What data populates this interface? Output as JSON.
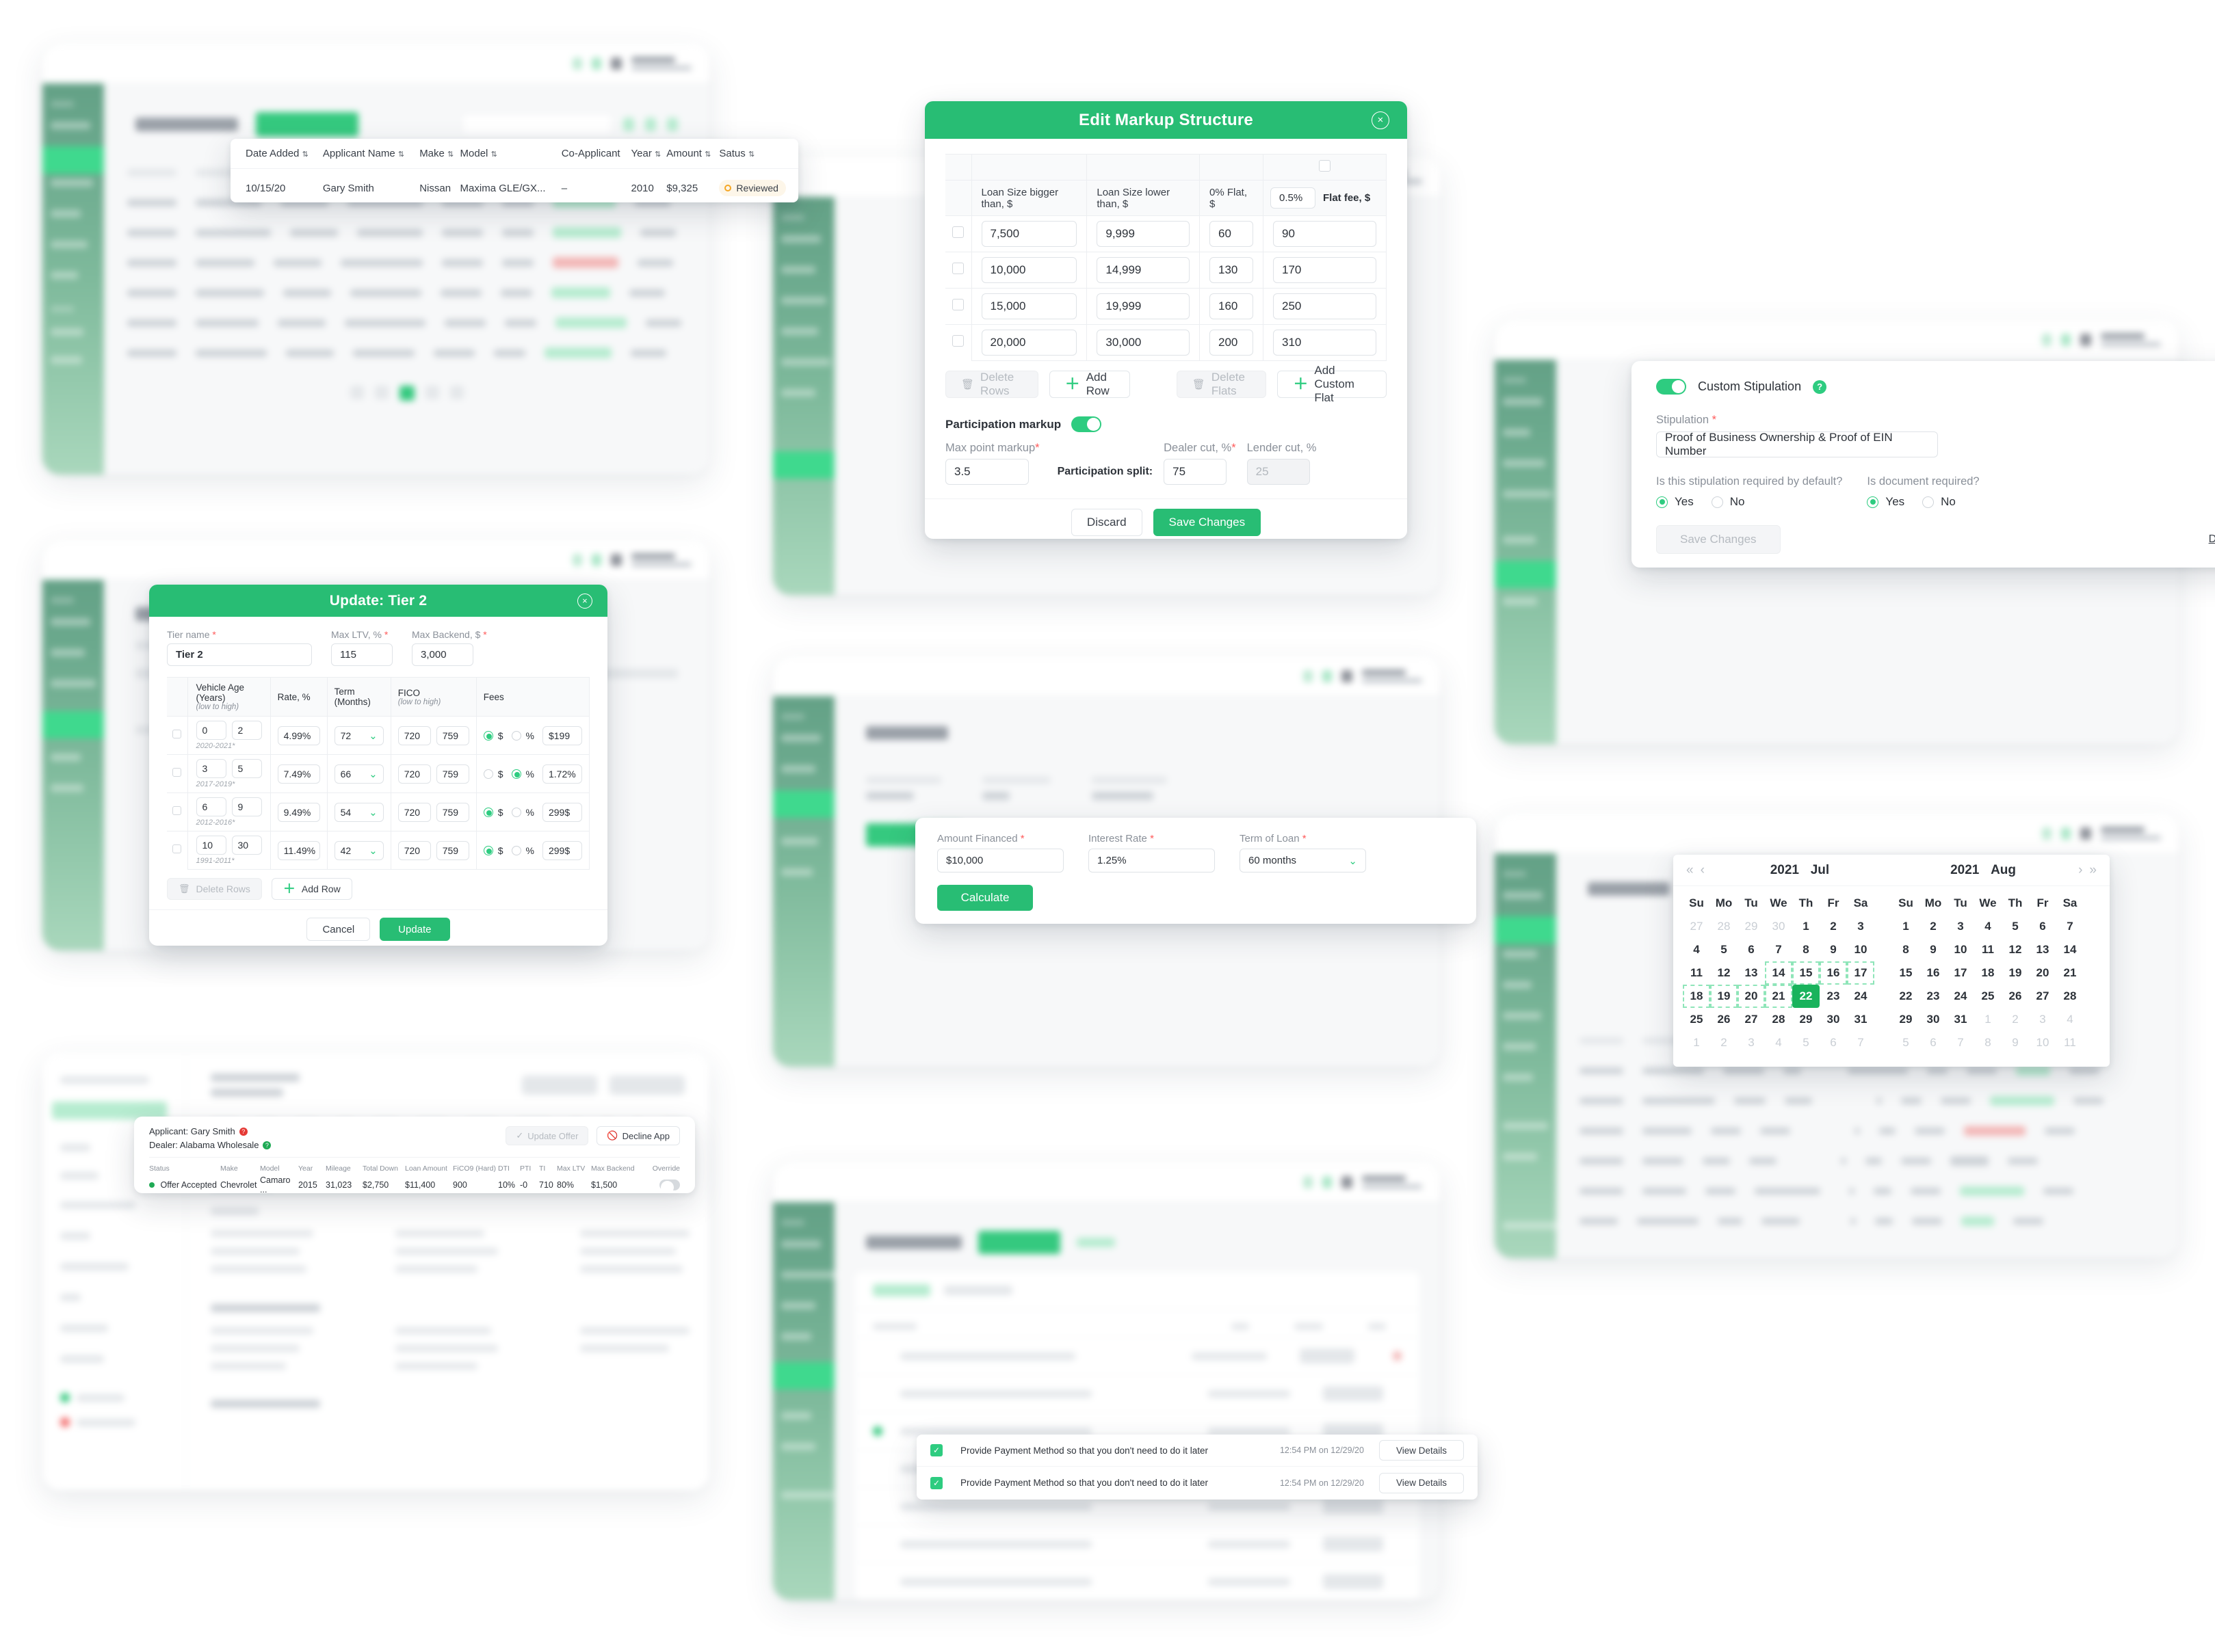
{
  "app": {
    "brand_green": "#28bd74",
    "accent_green": "#2ecc80"
  },
  "applications_table": {
    "columns": [
      "Date Added",
      "Applicant Name",
      "Make",
      "Model",
      "Co-Applicant",
      "Year",
      "Amount",
      "Satus"
    ],
    "rows": [
      {
        "date_added": "10/15/20",
        "applicant_name": "Gary Smith",
        "make": "Nissan",
        "model": "Maxima GLE/GX...",
        "co_applicant": "–",
        "year": "2010",
        "amount": "$9,325",
        "status": "Reviewed"
      }
    ]
  },
  "markup_modal": {
    "title": "Edit Markup Structure",
    "close_label": "×",
    "flat_pct_value": "0.5%",
    "columns": [
      "Loan Size bigger than, $",
      "Loan Size lower than, $",
      "0% Flat, $",
      "Flat fee, $"
    ],
    "rows": [
      {
        "bigger_than": "7,500",
        "lower_than": "9,999",
        "zero_flat": "60",
        "flat_fee": "90"
      },
      {
        "bigger_than": "10,000",
        "lower_than": "14,999",
        "zero_flat": "130",
        "flat_fee": "170"
      },
      {
        "bigger_than": "15,000",
        "lower_than": "19,999",
        "zero_flat": "160",
        "flat_fee": "250"
      },
      {
        "bigger_than": "20,000",
        "lower_than": "30,000",
        "zero_flat": "200",
        "flat_fee": "310"
      }
    ],
    "delete_rows_label": "Delete Rows",
    "add_row_label": "Add Row",
    "delete_flats_label": "Delete Flats",
    "add_custom_flat_label": "Add Custom Flat",
    "participation_title": "Participation markup",
    "participation_toggle": "on",
    "max_point_markup_label": "Max point markup",
    "max_point_markup_value": "3.5",
    "participation_split_label": "Participation split:",
    "dealer_cut_label": "Dealer cut, %",
    "dealer_cut_value": "75",
    "lender_cut_label": "Lender cut, %",
    "lender_cut_value": "25",
    "discard_label": "Discard",
    "save_label": "Save Changes"
  },
  "tier_modal": {
    "title": "Update: Tier 2",
    "close_label": "×",
    "tier_name_label": "Tier name",
    "tier_name_value": "Tier 2",
    "max_ltv_label": "Max LTV, %",
    "max_ltv_value": "115",
    "max_backend_label": "Max Backend, $",
    "max_backend_value": "3,000",
    "columns": {
      "vehicle_age": "Vehicle Age (Years)",
      "vehicle_age_hint": "(low to high)",
      "rate": "Rate, %",
      "term": "Term (Months)",
      "fico": "FICO",
      "fico_hint": "(low to high)",
      "fees": "Fees"
    },
    "rows": [
      {
        "age_low": "0",
        "age_high": "2",
        "years": "2020-2021*",
        "rate": "4.99%",
        "term": "72",
        "fico_low": "720",
        "fico_high": "759",
        "fee_mode": "dollar",
        "fee_value": "$199"
      },
      {
        "age_low": "3",
        "age_high": "5",
        "years": "2017-2019*",
        "rate": "7.49%",
        "term": "66",
        "fico_low": "720",
        "fico_high": "759",
        "fee_mode": "percent",
        "fee_value": "1.72%"
      },
      {
        "age_low": "6",
        "age_high": "9",
        "years": "2012-2016*",
        "rate": "9.49%",
        "term": "54",
        "fico_low": "720",
        "fico_high": "759",
        "fee_mode": "dollar",
        "fee_value": "299$"
      },
      {
        "age_low": "10",
        "age_high": "30",
        "years": "1991-2011*",
        "rate": "11.49%",
        "term": "42",
        "fico_low": "720",
        "fico_high": "759",
        "fee_mode": "dollar",
        "fee_value": "299$"
      }
    ],
    "fee_dollar_label": "$",
    "fee_percent_label": "%",
    "delete_rows_label": "Delete Rows",
    "add_row_label": "Add Row",
    "cancel_label": "Cancel",
    "update_label": "Update"
  },
  "stipulation_card": {
    "toggle_label": "Custom Stipulation",
    "toggle_state": "on",
    "help_icon": "?",
    "stipulation_label": "Stipulation",
    "stipulation_value": "Proof of Business Ownership & Proof of EIN Number",
    "required_default_question": "Is this stipulation required by default?",
    "document_required_question": "Is document required?",
    "yes_label": "Yes",
    "no_label": "No",
    "required_default_answer": "Yes",
    "document_required_answer": "Yes",
    "save_label": "Save Changes",
    "delete_label": "Delete Stipulation"
  },
  "calculator_card": {
    "amount_financed_label": "Amount Financed",
    "amount_financed_value": "$10,000",
    "interest_rate_label": "Interest Rate",
    "interest_rate_value": "1.25%",
    "term_of_loan_label": "Term of Loan",
    "term_of_loan_value": "60 months",
    "calculate_label": "Calculate"
  },
  "applicant_card": {
    "applicant_label": "Applicant: Gary Smith",
    "dealer_label": "Dealer: Alabama Wholesale",
    "update_offer_label": "Update Offer",
    "decline_app_label": "Decline App",
    "columns": [
      "Status",
      "Make",
      "Model",
      "Year",
      "Mileage",
      "Total Down",
      "Loan Amount",
      "FiCO9 (Hard)",
      "DTI",
      "PTI",
      "TI",
      "Max LTV",
      "Max Backend",
      "Override"
    ],
    "values": {
      "status": "Offer Accepted",
      "make": "Chevrolet",
      "model": "Camaro ...",
      "year": "2015",
      "mileage": "31,023",
      "total_down": "$2,750",
      "loan_amount": "$11,400",
      "fico9_hard": "900",
      "dti": "10%",
      "pti": "-0",
      "ti": "710",
      "max_ltv": "80%",
      "max_backend": "$1,500",
      "override": "off"
    }
  },
  "notifications_card": {
    "items": [
      {
        "text": "Provide Payment Method so that you don't need to do it later",
        "time": "12:54 PM on 12/29/20",
        "action": "View Details",
        "checked": true
      },
      {
        "text": "Provide Payment Method so that you don't need to do it later",
        "time": "12:54 PM on 12/29/20",
        "action": "View Details",
        "checked": true
      }
    ]
  },
  "date_range_picker": {
    "prev_year_icon": "«",
    "prev_month_icon": "‹",
    "next_month_icon": "›",
    "next_year_icon": "»",
    "weekdays": [
      "Su",
      "Mo",
      "Tu",
      "We",
      "Th",
      "Fr",
      "Sa"
    ],
    "left": {
      "year": "2021",
      "month": "Jul",
      "weeks": [
        [
          {
            "d": "27",
            "o": 1
          },
          {
            "d": "28",
            "o": 1
          },
          {
            "d": "29",
            "o": 1
          },
          {
            "d": "30",
            "o": 1
          },
          {
            "d": "1"
          },
          {
            "d": "2"
          },
          {
            "d": "3"
          }
        ],
        [
          {
            "d": "4"
          },
          {
            "d": "5"
          },
          {
            "d": "6"
          },
          {
            "d": "7"
          },
          {
            "d": "8"
          },
          {
            "d": "9"
          },
          {
            "d": "10"
          }
        ],
        [
          {
            "d": "11"
          },
          {
            "d": "12"
          },
          {
            "d": "13"
          },
          {
            "d": "14",
            "r": 1
          },
          {
            "d": "15",
            "r": 1
          },
          {
            "d": "16",
            "r": 1
          },
          {
            "d": "17",
            "r": 1
          }
        ],
        [
          {
            "d": "18",
            "r": 1
          },
          {
            "d": "19",
            "r": 1
          },
          {
            "d": "20",
            "r": 1
          },
          {
            "d": "21",
            "r": 1
          },
          {
            "d": "22",
            "s": 1
          },
          {
            "d": "23"
          },
          {
            "d": "24"
          }
        ],
        [
          {
            "d": "25"
          },
          {
            "d": "26"
          },
          {
            "d": "27"
          },
          {
            "d": "28"
          },
          {
            "d": "29"
          },
          {
            "d": "30"
          },
          {
            "d": "31"
          }
        ],
        [
          {
            "d": "1",
            "o": 1
          },
          {
            "d": "2",
            "o": 1
          },
          {
            "d": "3",
            "o": 1
          },
          {
            "d": "4",
            "o": 1
          },
          {
            "d": "5",
            "o": 1
          },
          {
            "d": "6",
            "o": 1
          },
          {
            "d": "7",
            "o": 1
          }
        ]
      ]
    },
    "right": {
      "year": "2021",
      "month": "Aug",
      "weeks": [
        [
          {
            "d": "1"
          },
          {
            "d": "2"
          },
          {
            "d": "3"
          },
          {
            "d": "4"
          },
          {
            "d": "5"
          },
          {
            "d": "6"
          },
          {
            "d": "7"
          }
        ],
        [
          {
            "d": "8"
          },
          {
            "d": "9"
          },
          {
            "d": "10"
          },
          {
            "d": "11"
          },
          {
            "d": "12"
          },
          {
            "d": "13"
          },
          {
            "d": "14"
          }
        ],
        [
          {
            "d": "15"
          },
          {
            "d": "16"
          },
          {
            "d": "17"
          },
          {
            "d": "18"
          },
          {
            "d": "19"
          },
          {
            "d": "20"
          },
          {
            "d": "21"
          }
        ],
        [
          {
            "d": "22"
          },
          {
            "d": "23"
          },
          {
            "d": "24"
          },
          {
            "d": "25"
          },
          {
            "d": "26"
          },
          {
            "d": "27"
          },
          {
            "d": "28"
          }
        ],
        [
          {
            "d": "29"
          },
          {
            "d": "30"
          },
          {
            "d": "31"
          },
          {
            "d": "1",
            "o": 1
          },
          {
            "d": "2",
            "o": 1
          },
          {
            "d": "3",
            "o": 1
          },
          {
            "d": "4",
            "o": 1
          }
        ],
        [
          {
            "d": "5",
            "o": 1
          },
          {
            "d": "6",
            "o": 1
          },
          {
            "d": "7",
            "o": 1
          },
          {
            "d": "8",
            "o": 1
          },
          {
            "d": "9",
            "o": 1
          },
          {
            "d": "10",
            "o": 1
          },
          {
            "d": "11",
            "o": 1
          }
        ]
      ]
    }
  }
}
